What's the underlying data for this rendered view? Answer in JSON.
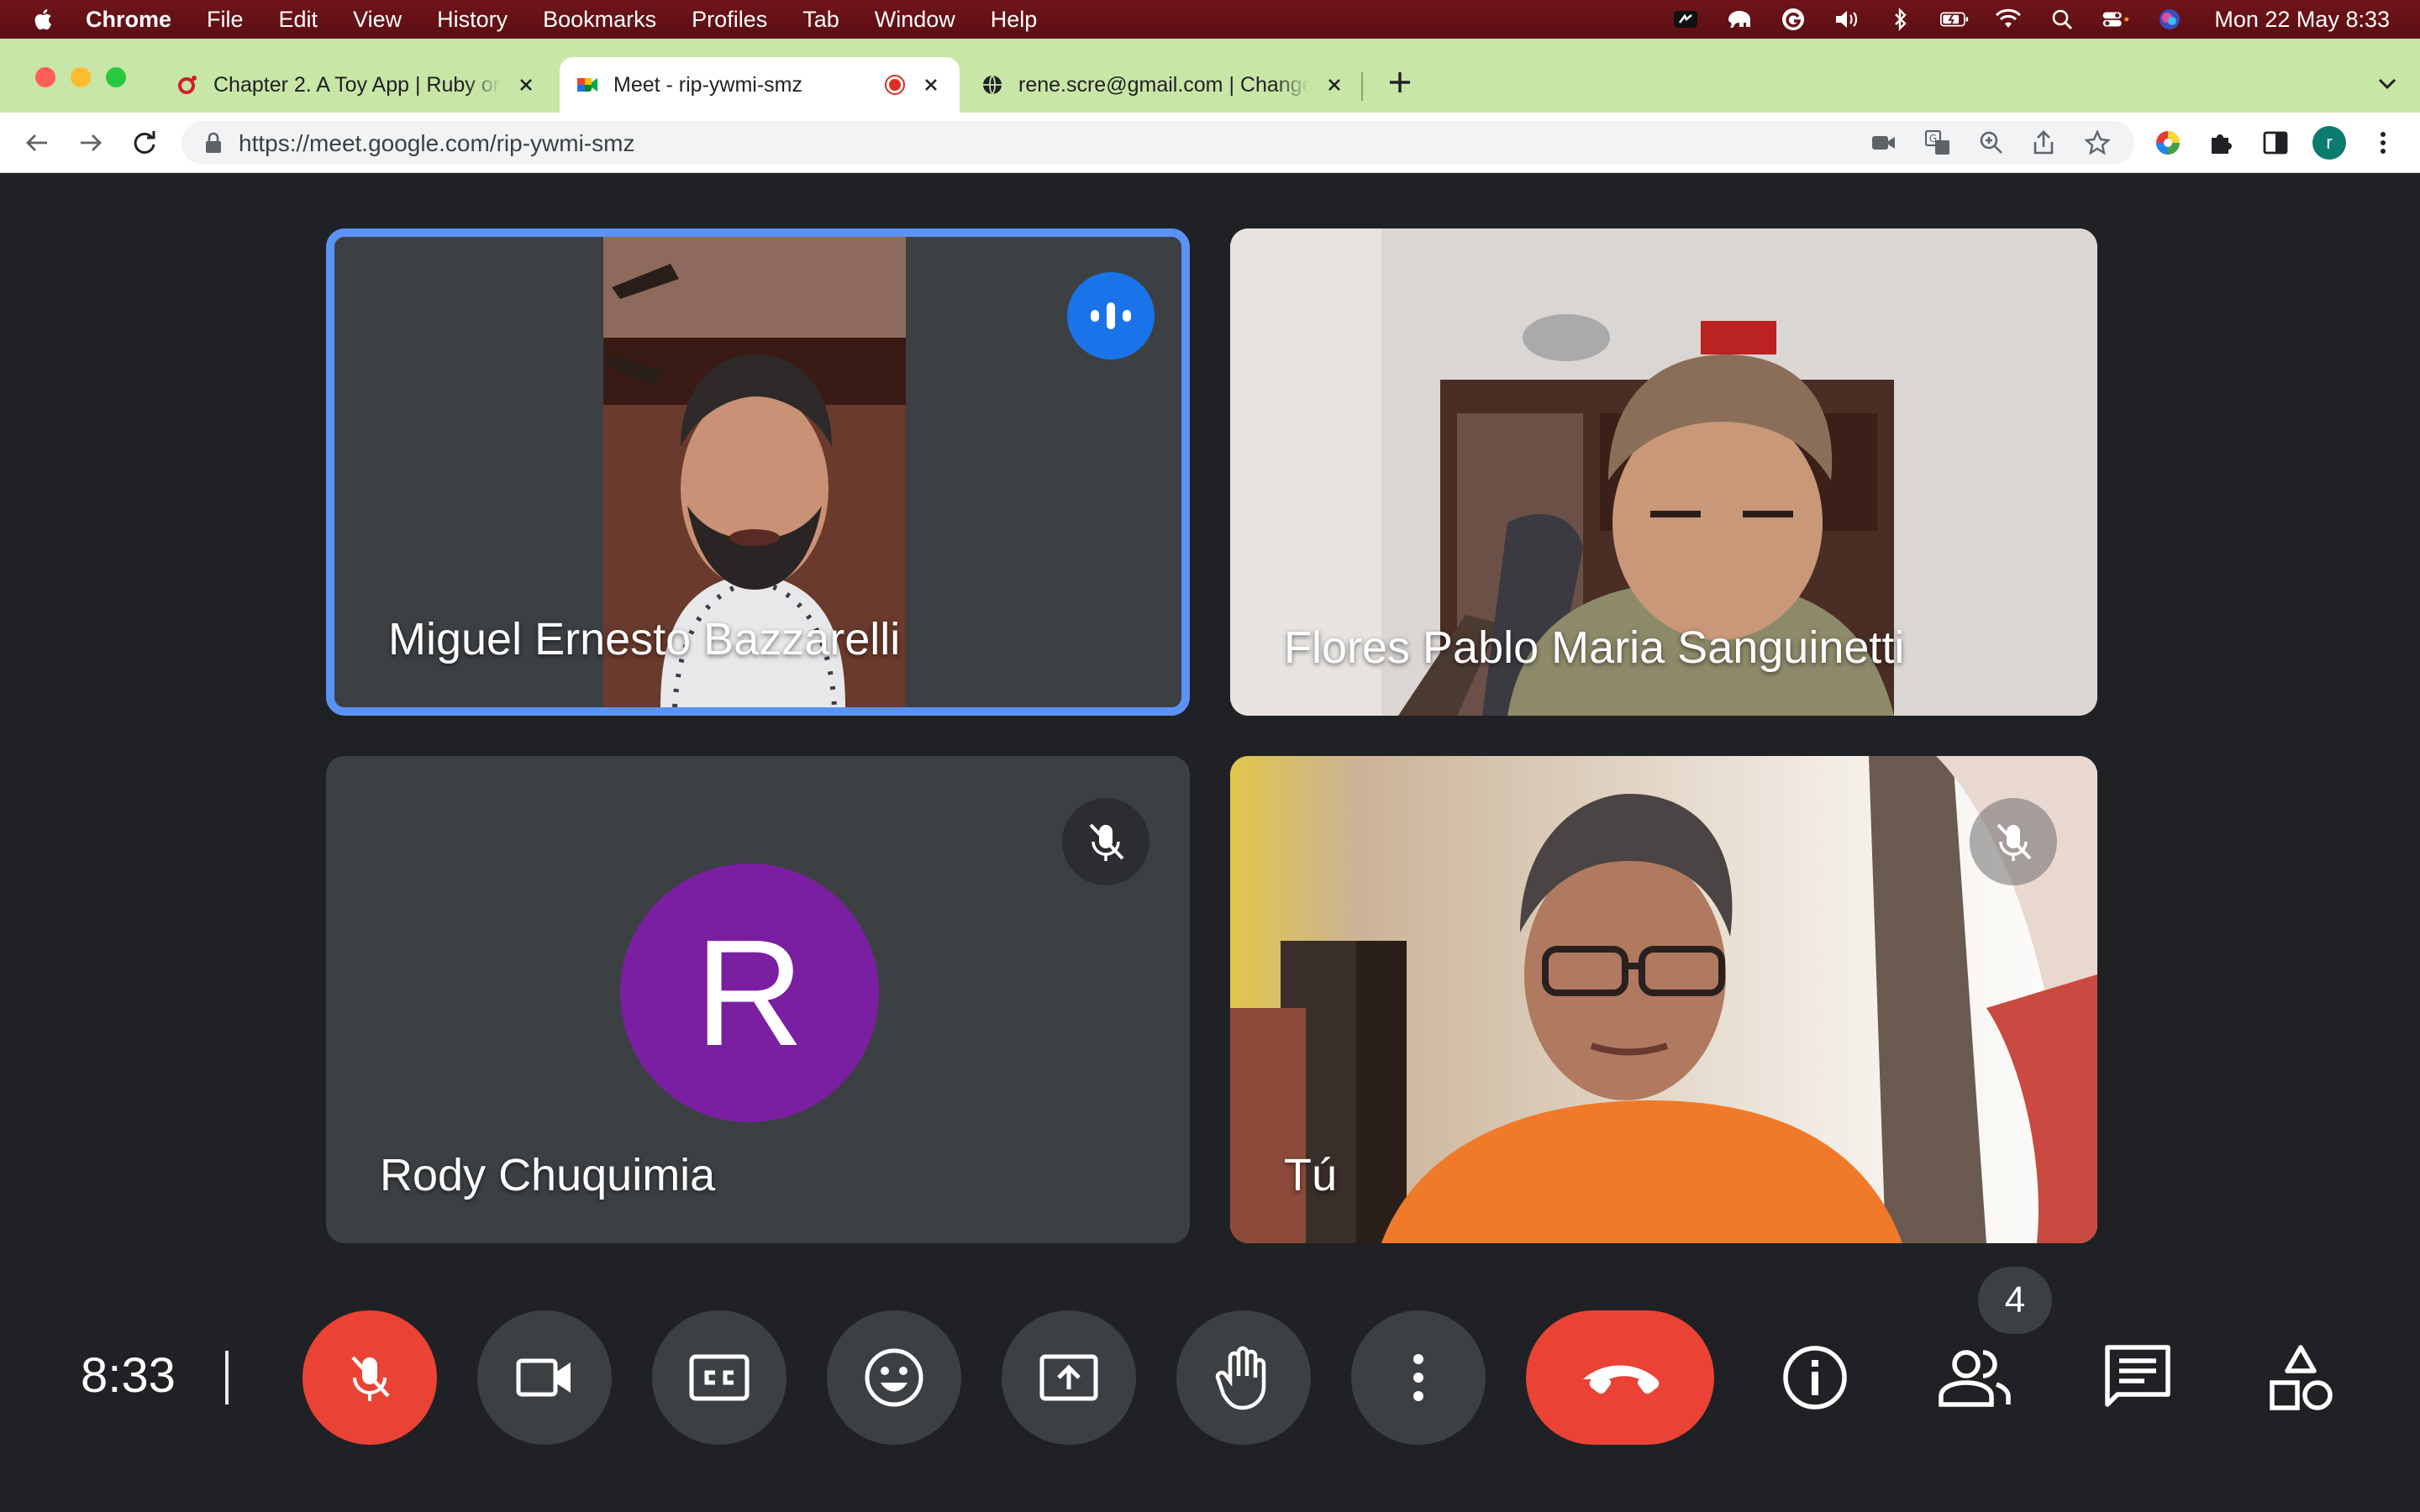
{
  "menubar": {
    "app": "Chrome",
    "items": [
      "File",
      "Edit",
      "View",
      "History",
      "Bookmarks",
      "Profiles",
      "Tab",
      "Window",
      "Help"
    ],
    "clock": "Mon 22 May  8:33"
  },
  "tabs": [
    {
      "title": "Chapter 2. A Toy App | Ruby on Rails",
      "active": false
    },
    {
      "title": "Meet - rip-ywmi-smz",
      "active": true,
      "recording": true
    },
    {
      "title": "rene.scre@gmail.com | Change",
      "active": false
    }
  ],
  "toolbar": {
    "url": "https://meet.google.com/rip-ywmi-smz",
    "profile_initial": "r"
  },
  "participants": [
    {
      "name": "Miguel Ernesto Bazzarelli",
      "speaking": true,
      "muted": false
    },
    {
      "name": "Flores Pablo Maria Sanguinetti",
      "speaking": false,
      "muted": false
    },
    {
      "name": "Rody Chuquimia",
      "initial": "R",
      "avatar_color": "#7a1fa2",
      "muted": true
    },
    {
      "name": "Tú",
      "muted": true
    }
  ],
  "controls": {
    "time": "8:33",
    "participant_count": "4"
  },
  "colors": {
    "meet_bg": "#202124",
    "tile_bg": "#3c4043",
    "danger": "#ea4335",
    "active_speaker": "#5b92f5",
    "speaking_badge": "#1a73e8"
  }
}
